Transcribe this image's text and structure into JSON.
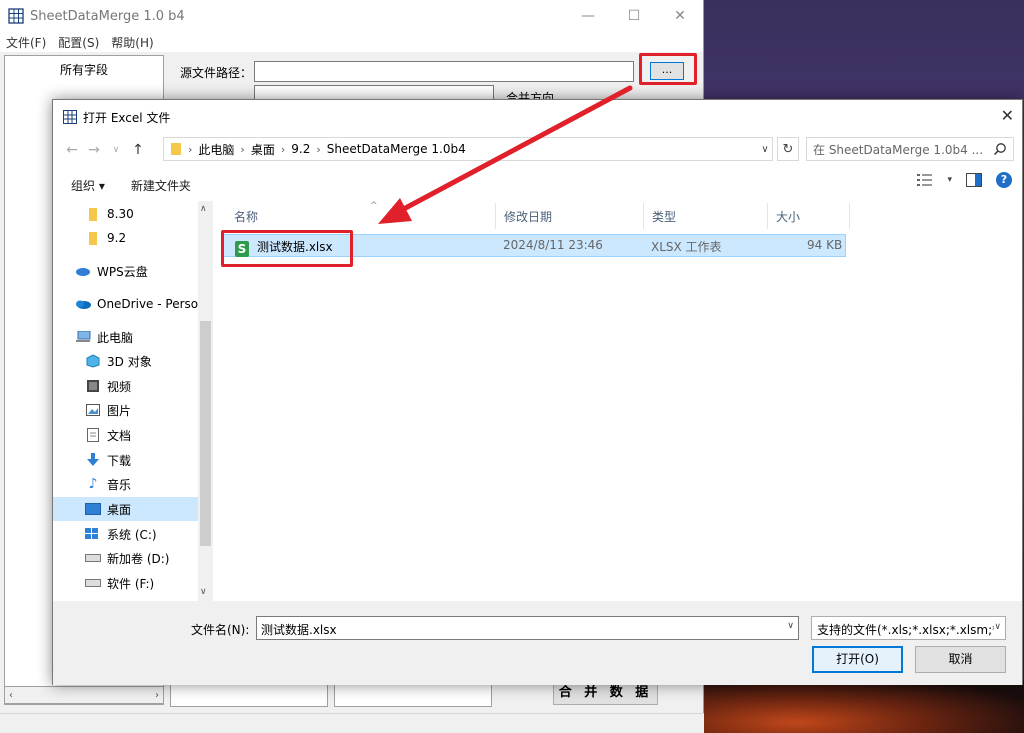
{
  "app": {
    "title": "SheetDataMerge 1.0 b4",
    "menu": [
      "文件(F)",
      "配置(S)",
      "帮助(H)"
    ],
    "field_list_header": "所有字段",
    "source_path_label": "源文件路径：",
    "browse_label": "...",
    "merge_direction_label": "合并方向",
    "merge_button": "合 并 数 据"
  },
  "dialog": {
    "title": "打开 Excel 文件",
    "breadcrumb": [
      "此电脑",
      "桌面",
      "9.2",
      "SheetDataMerge 1.0b4"
    ],
    "search_placeholder": "在 SheetDataMerge 1.0b4 ...",
    "toolbar": {
      "organize": "组织 ▾",
      "new_folder": "新建文件夹"
    },
    "nav_items": [
      {
        "label": "8.30",
        "icon": "folder-icon"
      },
      {
        "label": "9.2",
        "icon": "folder-icon"
      },
      {
        "label": "WPS云盘",
        "icon": "cloud-icon"
      },
      {
        "label": "OneDrive - Perso",
        "icon": "onedrive-icon"
      },
      {
        "label": "此电脑",
        "icon": "computer-icon"
      },
      {
        "label": "3D 对象",
        "icon": "3d-objects-icon"
      },
      {
        "label": "视频",
        "icon": "video-icon"
      },
      {
        "label": "图片",
        "icon": "picture-icon"
      },
      {
        "label": "文档",
        "icon": "document-icon"
      },
      {
        "label": "下载",
        "icon": "download-icon"
      },
      {
        "label": "音乐",
        "icon": "music-icon"
      },
      {
        "label": "桌面",
        "icon": "desktop-icon"
      },
      {
        "label": "系统 (C:)",
        "icon": "drive-icon"
      },
      {
        "label": "新加卷 (D:)",
        "icon": "drive-icon"
      },
      {
        "label": "软件 (F:)",
        "icon": "drive-icon"
      }
    ],
    "columns": [
      "名称",
      "修改日期",
      "类型",
      "大小"
    ],
    "files": [
      {
        "name": "测试数据.xlsx",
        "modified": "2024/8/11 23:46",
        "type": "XLSX 工作表",
        "size": "94 KB"
      }
    ],
    "filename_label": "文件名(N):",
    "filename_value": "测试数据.xlsx",
    "filter_value": "支持的文件(*.xls;*.xlsx;*.xlsm;*",
    "open_button": "打开(O)",
    "cancel_button": "取消"
  },
  "colors": {
    "highlight_red": "#e0202a",
    "selection_blue": "#cce8ff",
    "accent": "#0078d7"
  }
}
